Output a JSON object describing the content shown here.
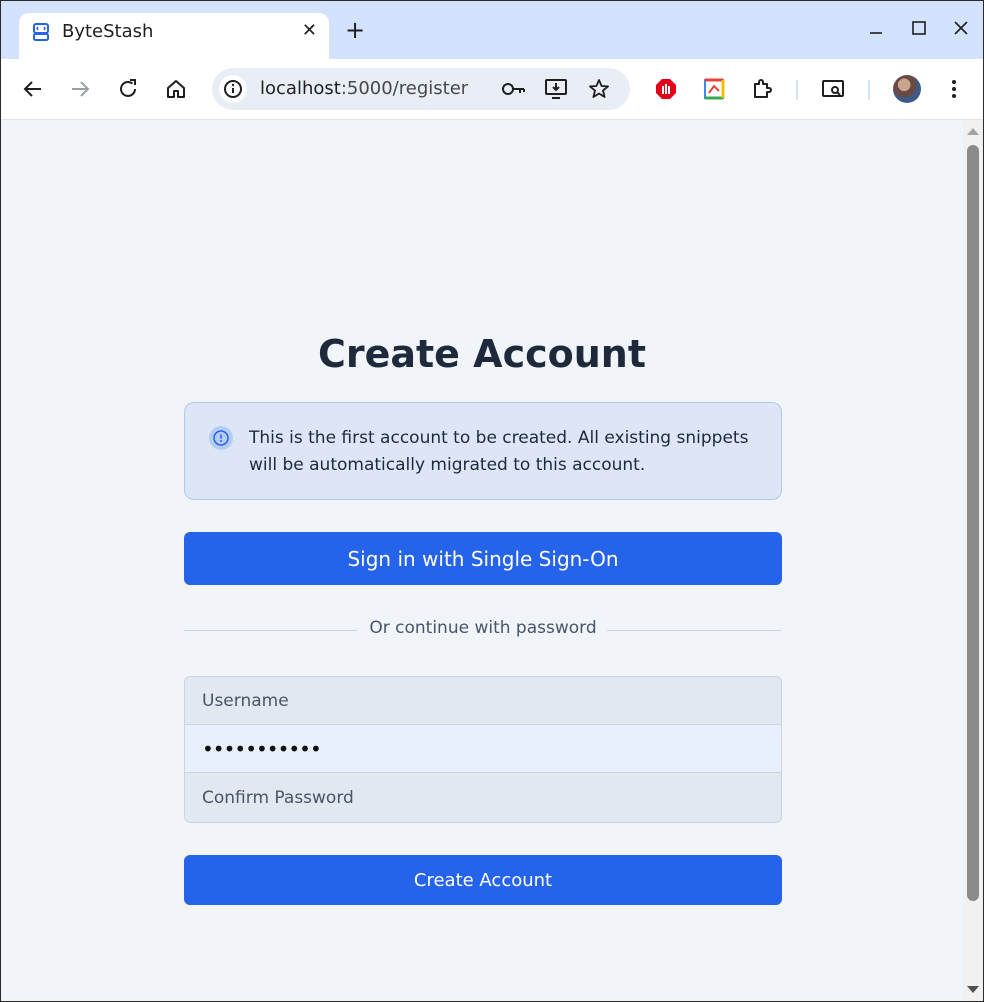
{
  "browser": {
    "tab_title": "ByteStash",
    "tab_close": "✕",
    "new_tab": "+",
    "url_host": "localhost",
    "url_rest": ":5000/register"
  },
  "page": {
    "heading": "Create Account",
    "notice": "This is the first account to be created. All existing snippets will be automatically migrated to this account.",
    "sso_button": "Sign in with Single Sign-On",
    "divider_text": "Or continue with password",
    "username_placeholder": "Username",
    "password_value": "•••••••••••",
    "confirm_placeholder": "Confirm Password",
    "submit_button": "Create Account"
  },
  "colors": {
    "primary": "#2563eb",
    "notice_bg": "#dde6f7",
    "page_bg": "#f1f5f9",
    "tabstrip_bg": "#d3e3fd"
  }
}
